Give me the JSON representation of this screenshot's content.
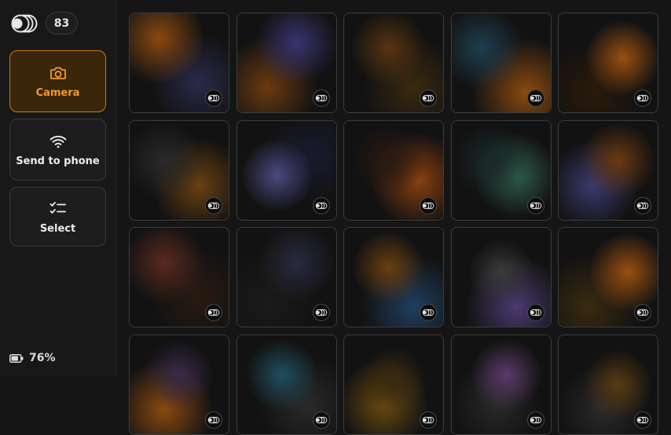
{
  "header": {
    "count": "83",
    "brand_icon": "concentric-circles-logo"
  },
  "sidebar": {
    "buttons": [
      {
        "label": "Camera",
        "icon": "camera-icon",
        "active": true
      },
      {
        "label": "Send to phone",
        "icon": "wifi-icon",
        "active": false
      },
      {
        "label": "Select",
        "icon": "checklist-icon",
        "active": false
      }
    ]
  },
  "status": {
    "battery": "76%"
  },
  "colors": {
    "accent": "#f29a2e",
    "accent_bg": "#3a2608",
    "border": "#3a3a3a"
  },
  "gallery": {
    "tiles": [
      {
        "tone": "#8a4a10",
        "tone2": "#2a2a4a"
      },
      {
        "tone": "#3a3470",
        "tone2": "#6a3a10"
      },
      {
        "tone": "#5a3410",
        "tone2": "#3a2a10"
      },
      {
        "tone": "#1f3f4f",
        "tone2": "#8a4a10"
      },
      {
        "tone": "#9a5010",
        "tone2": "#2a1a0a"
      },
      {
        "tone": "#2a2a2a",
        "tone2": "#6a4010"
      },
      {
        "tone": "#4a4a80",
        "tone2": "#1a1a30"
      },
      {
        "tone": "#2a1a10",
        "tone2": "#8a4010"
      },
      {
        "tone": "#1a2a2a",
        "tone2": "#2f5f4f"
      },
      {
        "tone": "#6a3a10",
        "tone2": "#3a3a70"
      },
      {
        "tone": "#5a2a20",
        "tone2": "#2a1a10"
      },
      {
        "tone": "#2a2a40",
        "tone2": "#1a1a1a"
      },
      {
        "tone": "#6a4010",
        "tone2": "#1f3f5f"
      },
      {
        "tone": "#3a3a3a",
        "tone2": "#4a3a70"
      },
      {
        "tone": "#9a5010",
        "tone2": "#3a2a10"
      },
      {
        "tone": "#3a2a4a",
        "tone2": "#8a4a10"
      },
      {
        "tone": "#1f4f5f",
        "tone2": "#2a2a2a"
      },
      {
        "tone": "#3a2a10",
        "tone2": "#6a4a10"
      },
      {
        "tone": "#5a3a6a",
        "tone2": "#2a2a2a"
      },
      {
        "tone": "#5a3a10",
        "tone2": "#2a2a2a"
      }
    ]
  }
}
